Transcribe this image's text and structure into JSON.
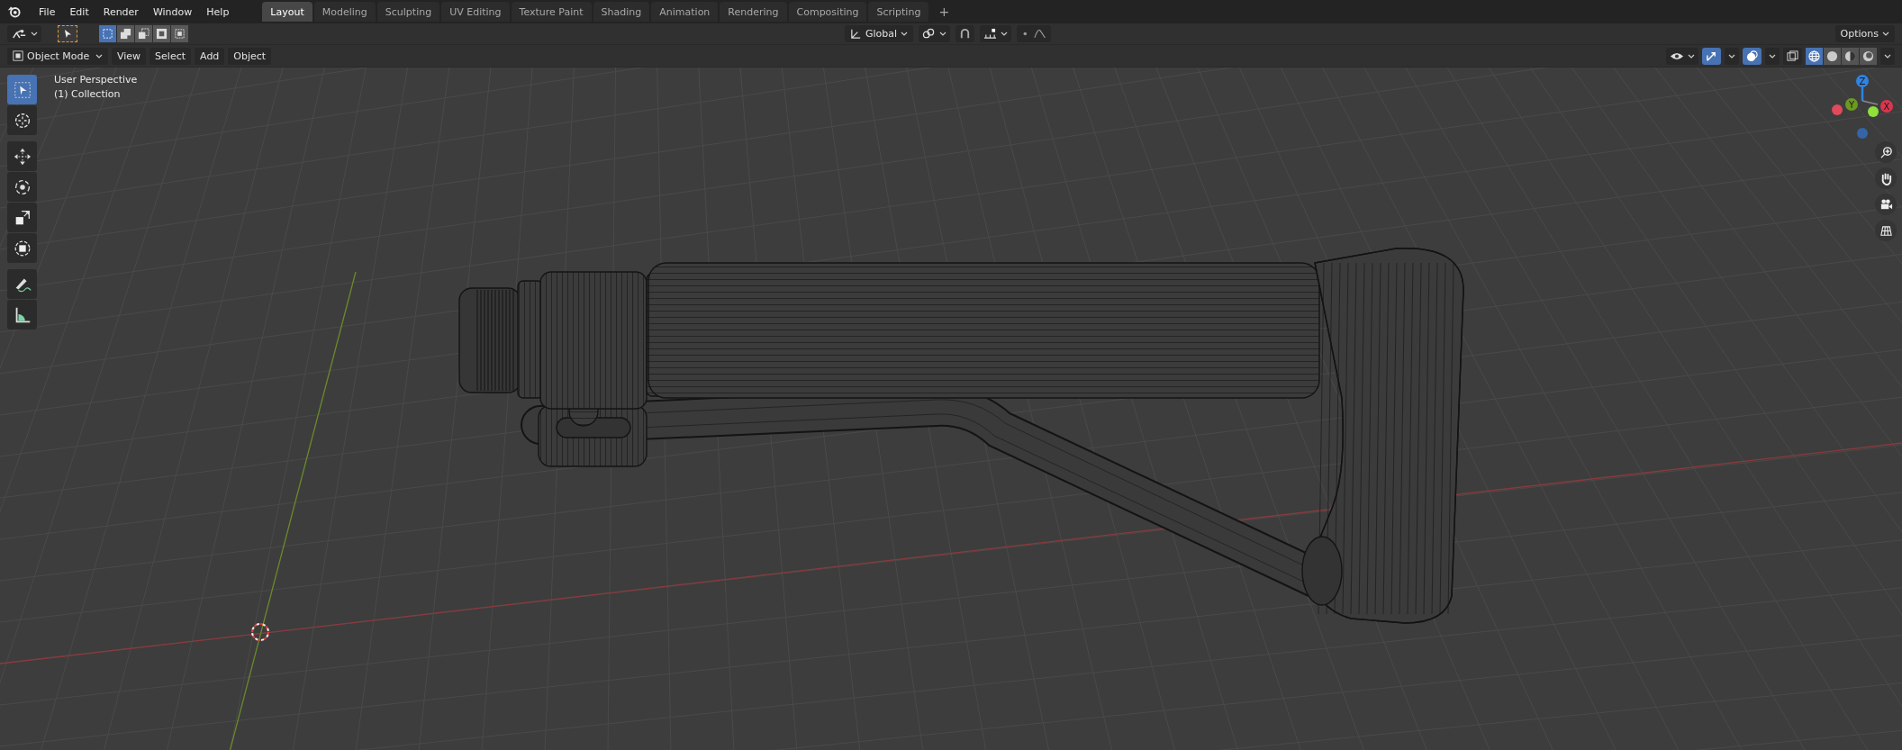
{
  "menu": [
    "File",
    "Edit",
    "Render",
    "Window",
    "Help"
  ],
  "workspace_tabs": [
    {
      "label": "Layout",
      "selected": true
    },
    {
      "label": "Modeling",
      "selected": false
    },
    {
      "label": "Sculpting",
      "selected": false
    },
    {
      "label": "UV Editing",
      "selected": false
    },
    {
      "label": "Texture Paint",
      "selected": false
    },
    {
      "label": "Shading",
      "selected": false
    },
    {
      "label": "Animation",
      "selected": false
    },
    {
      "label": "Rendering",
      "selected": false
    },
    {
      "label": "Compositing",
      "selected": false
    },
    {
      "label": "Scripting",
      "selected": false
    }
  ],
  "add_tab": "+",
  "tool_header": {
    "select_modes": [
      {
        "kind": "set",
        "selected": true
      },
      {
        "kind": "extend",
        "selected": false
      },
      {
        "kind": "subtract",
        "selected": false
      },
      {
        "kind": "difference",
        "selected": false
      },
      {
        "kind": "intersect",
        "selected": false
      }
    ],
    "orientation": "Global",
    "options": "Options"
  },
  "viewport_header": {
    "mode": "Object Mode",
    "menus": [
      "View",
      "Select",
      "Add",
      "Object"
    ],
    "gizmos_on": true,
    "overlays_on": true,
    "xray_on": false,
    "shading": [
      {
        "kind": "wireframe",
        "selected": true
      },
      {
        "kind": "solid",
        "selected": false
      },
      {
        "kind": "material",
        "selected": false
      },
      {
        "kind": "rendered",
        "selected": false
      }
    ]
  },
  "toolbar": [
    {
      "kind": "select",
      "selected": true
    },
    {
      "kind": "cursor",
      "selected": false
    },
    {
      "kind": "move",
      "selected": false
    },
    {
      "kind": "rotate",
      "selected": false
    },
    {
      "kind": "scale",
      "selected": false
    },
    {
      "kind": "transform",
      "selected": false
    },
    {
      "kind": "annotate",
      "selected": false
    },
    {
      "kind": "measure",
      "selected": false
    }
  ],
  "viewport": {
    "view_name": "User Perspective",
    "collection": "(1) Collection"
  },
  "gizmo": {
    "axes": [
      {
        "label": "Z",
        "color": "#2f84e3"
      },
      {
        "label": "Y",
        "color": "#6b9a1f"
      },
      {
        "label": "X",
        "color": "#d8374f"
      }
    ]
  }
}
